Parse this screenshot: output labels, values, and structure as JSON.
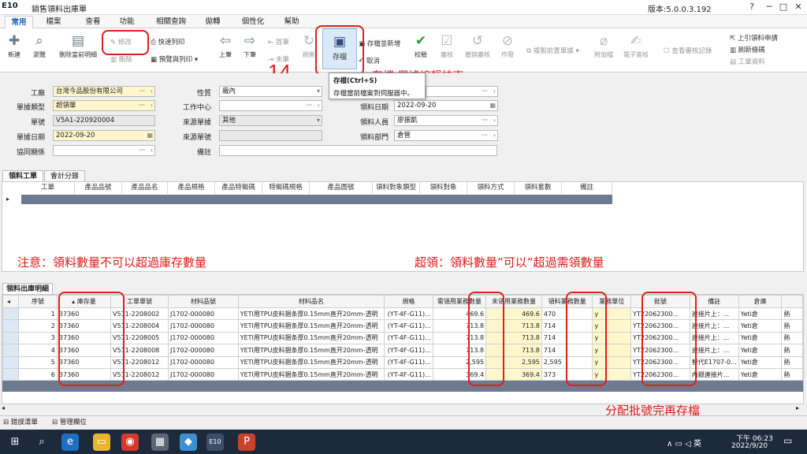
{
  "window": {
    "logo": "E10",
    "title": "銷售領料出庫單",
    "version": "版本:5.0.0.3.192",
    "buttons": {
      "help": "?",
      "minimize": "─",
      "maximize": "□",
      "close": "✕"
    }
  },
  "ribbon_tabs": [
    "常用",
    "檔案",
    "查看",
    "功能",
    "相關查詢",
    "拋轉",
    "個性化",
    "幫助"
  ],
  "ribbon": {
    "add": "新建",
    "browse": "瀏覽",
    "delete_current": "刪除當前明細",
    "modify": "修改",
    "remove": "刪除",
    "quick_print": "快速列印",
    "preview_print": "預覽與列印 ▾",
    "prev": "上筆",
    "next": "下筆",
    "first": "首筆",
    "last": "末筆",
    "refresh": "刷新",
    "save": "存檔",
    "save_new": "存檔並新增",
    "cancel": "取消",
    "verify": "校驗",
    "approve": "審核",
    "revoke": "撤銷審核",
    "void": "作廢",
    "copy_prev": "複製前置單據 ▾",
    "attach": "附加檔",
    "esign": "電子簽核",
    "view_audit": "查看審核記錄",
    "prev_req": "上引領料申請",
    "refresh_batch": "刷新條碼",
    "worksheet": "工單資料"
  },
  "tooltip": {
    "title": "存檔(Ctrl+S)",
    "desc": "存檔當前檔案到伺服器中。"
  },
  "annotations": {
    "step": "14",
    "save_note": "存檔 單據編輯結束",
    "note_qty": "注意：領料數量不可以超過庫存數量",
    "note_over": "超領：領料數量”可以”超過需領數量",
    "note_batch": "分配批號完再存檔"
  },
  "form": {
    "labels": {
      "factory": "工廠",
      "doc_type": "單據類型",
      "doc_no": "單號",
      "doc_date": "單據日期",
      "partner": "協同關係",
      "nature": "性質",
      "work_center": "工作中心",
      "source_doc": "來源單據",
      "source_no": "來源單號",
      "remark": "備註",
      "issue_date": "領料日期",
      "issuer": "領料人員",
      "issue_dept": "領料部門"
    },
    "values": {
      "factory": "台灣今品股份有限公司",
      "doc_type": "超領單",
      "doc_no": "V5A1-220920004",
      "doc_date": "2022-09-20",
      "partner": "",
      "nature": "廠內",
      "work_center": "",
      "source_doc": "其他",
      "source_no": "",
      "remark": "",
      "issue_date": "2022-09-20",
      "issuer": "廖振凱",
      "issue_dept": "倉管"
    }
  },
  "grid_tabs_top": [
    "領料工單",
    "會計分錄"
  ],
  "grid1_headers": [
    "工單",
    "產品品號",
    "產品品名",
    "產品規格",
    "產品特徵碼",
    "特徵碼規格",
    "產品圖號",
    "領料對象類型",
    "領料對象",
    "領料方式",
    "領料套數",
    "備註"
  ],
  "grid2_tab": "領料出庫明細",
  "grid2_headers": [
    "序號",
    "庫存量",
    "工單單號",
    "材料品號",
    "材料品名",
    "規格",
    "需領用業務數量",
    "未領用業務數量",
    "領料業務數量",
    "業務單位",
    "批號",
    "備註",
    "倉庫",
    ""
  ],
  "grid2_rows": [
    [
      "1",
      "37360",
      "V511-2208002",
      "J1702-000080",
      "YETI用TPU皮料捆条厚0.15mm直开20mm-透明",
      "(YT-4F-G11)...",
      "469.6",
      "469.6",
      "470",
      "y",
      "YT22062300...",
      "連接片上：...",
      "Yeti倉",
      "熱"
    ],
    [
      "2",
      "37360",
      "V511-2208004",
      "J1702-000080",
      "YETI用TPU皮料捆条厚0.15mm直开20mm-透明",
      "(YT-4F-G11)...",
      "713.8",
      "713.8",
      "714",
      "y",
      "YT22062300...",
      "連接片上：...",
      "Yeti倉",
      "熱"
    ],
    [
      "3",
      "37360",
      "V511-2208005",
      "J1702-000080",
      "YETI用TPU皮料捆条厚0.15mm直开20mm-透明",
      "(YT-4F-G11)...",
      "713.8",
      "713.8",
      "714",
      "y",
      "YT22062300...",
      "連接片上：...",
      "Yeti倉",
      "熱"
    ],
    [
      "4",
      "37360",
      "V511-2208008",
      "J1702-000080",
      "YETI用TPU皮料捆条厚0.15mm直开20mm-透明",
      "(YT-4F-G11)...",
      "713.8",
      "713.8",
      "714",
      "y",
      "YT22062300...",
      "連接片上：...",
      "Yeti倉",
      "熱"
    ],
    [
      "5",
      "37360",
      "V511-2208012",
      "J1702-000080",
      "YETI用TPU皮料捆条厚0.15mm直开20mm-透明",
      "(YT-4F-G11)...",
      "2,595",
      "2,595",
      "2,595",
      "y",
      "YT22062300...",
      "替代E1707-0...",
      "Yeti倉",
      "熱"
    ],
    [
      "6",
      "37360",
      "V511-2208012",
      "J1702-000080",
      "YETI用TPU皮料捆条厚0.15mm直开20mm-透明",
      "(YT-4F-G11)...",
      "369.4",
      "369.4",
      "373",
      "y",
      "YT22062300...",
      "內銀連接片...",
      "Yeti倉",
      "熱"
    ]
  ],
  "bottom_tabs": [
    "錯誤清單",
    "管理欄位"
  ],
  "taskbar": {
    "e10": "E10",
    "ime": "英",
    "time": "下午 06:23",
    "date": "2022/9/20"
  }
}
